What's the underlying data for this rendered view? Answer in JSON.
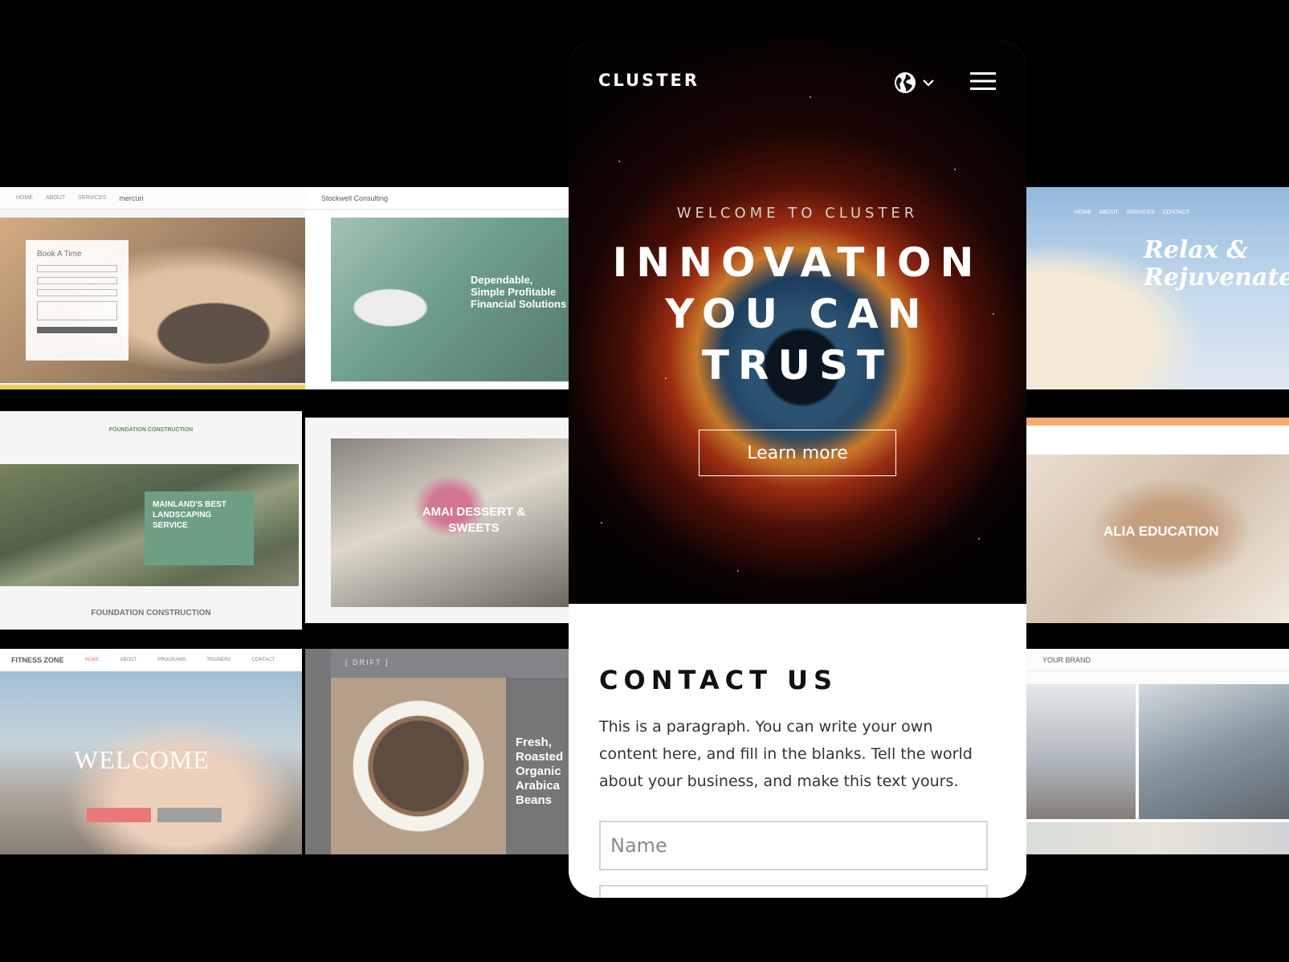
{
  "phone": {
    "logo": "CLUSTER",
    "eyebrow": "WELCOME TO CLUSTER",
    "headline": "INNOVATION\nYOU CAN\nTRUST",
    "cta": "Learn more",
    "contact_title": "CONTACT US",
    "contact_paragraph": "This is a paragraph. You can write your own content here, and fill in the blanks. Tell the world about your business, and make this text yours.",
    "name_placeholder": "Name",
    "icons": [
      "globe-icon",
      "chevron-down-icon",
      "hamburger-menu-icon"
    ]
  },
  "templates": {
    "mercuri": {
      "brand": "mercuri",
      "form_title": "Book A Time"
    },
    "stockwell": {
      "brand": "Stockwell Consulting",
      "headline": "Dependable, Simple Profitable Financial Solutions"
    },
    "foundation": {
      "logo": "FOUNDATION CONSTRUCTION",
      "headline": "MAINLAND'S BEST LANDSCAPING SERVICE",
      "caption": "FOUNDATION CONSTRUCTION"
    },
    "amai": {
      "headline": "AMAI DESSERT & SWEETS"
    },
    "fitness": {
      "brand": "FITNESS ZONE",
      "nav": [
        "HOME",
        "ABOUT",
        "PROGRAMS",
        "TRAINERS",
        "CONTACT"
      ],
      "headline": "WELCOME"
    },
    "drift": {
      "brand": "[ DRIFT ]",
      "headline": "Fresh, Roasted Organic Arabica Beans"
    },
    "relax": {
      "nav": "HOME ABOUT SERVICES CONTACT",
      "headline": "Relax & Rejuvenate"
    },
    "alia": {
      "headline": "ALIA EDUCATION"
    },
    "brand": {
      "brand": "YOUR BRAND"
    }
  }
}
